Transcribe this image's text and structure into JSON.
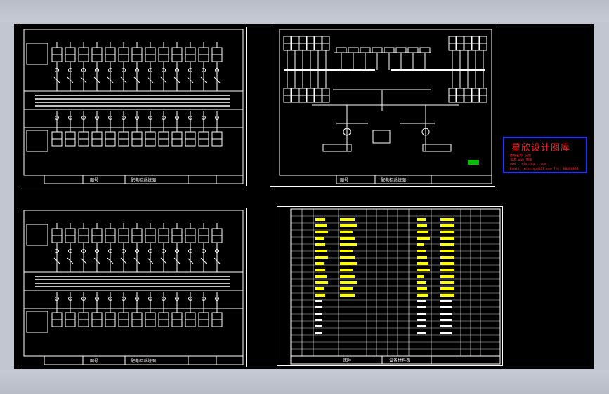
{
  "viewport": {
    "background": "#c2c6d0",
    "canvas_background": "#000000"
  },
  "colors": {
    "line": "#ffffff",
    "highlight": "#ffff00",
    "accent_green": "#00c000",
    "stamp_red": "#ff1f1f",
    "stamp_blue": "#1f34ff"
  },
  "sheets": {
    "top_left": {
      "title_label": "图号",
      "sheet_caption": "配电柜系统图"
    },
    "top_right": {
      "title_label": "图号",
      "sheet_caption": "配电柜系统图"
    },
    "bottom_left": {
      "title_label": "图号",
      "sheet_caption": "配电柜系统图"
    },
    "bottom_right": {
      "title_label": "图号",
      "sheet_caption": "设备材料表"
    }
  },
  "stamp": {
    "title": "星欣设计图库",
    "line1": "图纸名称 说明",
    "line2": "资源 www 图库",
    "line3": "www . xinxing . com",
    "line4": "Email: xinxing@163.com  Tel: 88888888"
  }
}
